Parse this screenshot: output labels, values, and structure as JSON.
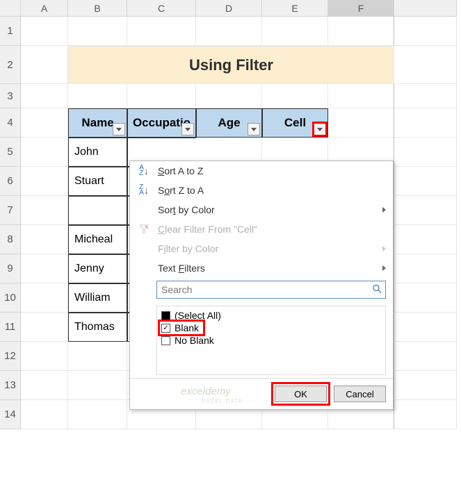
{
  "columns": [
    "A",
    "B",
    "C",
    "D",
    "E",
    "F"
  ],
  "rows": [
    "1",
    "2",
    "3",
    "4",
    "5",
    "6",
    "7",
    "8",
    "9",
    "10",
    "11",
    "12",
    "13",
    "14"
  ],
  "title": "Using Filter",
  "headers": {
    "name": "Name",
    "occupation": "Occupation",
    "age": "Age",
    "cell": "Cell"
  },
  "data": {
    "names": [
      "John",
      "Stuart",
      "",
      "Micheal",
      "Jenny",
      "William",
      "Thomas"
    ]
  },
  "dropdown": {
    "sort_az": "Sort A to Z",
    "sort_za": "Sort Z to A",
    "sort_color": "Sort by Color",
    "clear_filter": "Clear Filter From \"Cell\"",
    "filter_color": "Filter by Color",
    "text_filters": "Text Filters",
    "search_placeholder": "Search",
    "options": {
      "select_all": "(Select All)",
      "blank": "Blank",
      "no_blank": "No Blank"
    },
    "buttons": {
      "ok": "OK",
      "cancel": "Cancel"
    }
  },
  "watermark": "exceldemy",
  "watermark_sub": "EXCEL·DATA·······"
}
